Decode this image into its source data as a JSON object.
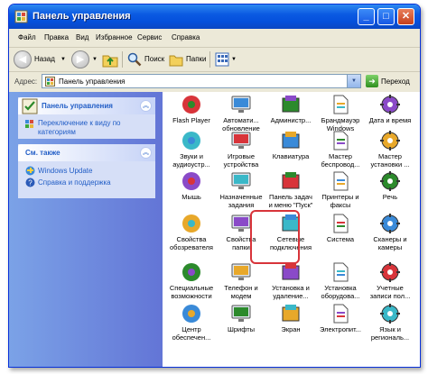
{
  "window": {
    "title": "Панель управления",
    "buttons": {
      "minimize": "_",
      "maximize": "□",
      "close": "✕"
    }
  },
  "menu": [
    "Файл",
    "Правка",
    "Вид",
    "Избранное",
    "Сервис",
    "Справка"
  ],
  "toolbar": {
    "back_label": "Назад",
    "search_label": "Поиск",
    "folders_label": "Папки"
  },
  "address": {
    "label": "Адрес:",
    "value": "Панель управления",
    "go_label": "Переход"
  },
  "sidebar": {
    "control_panel": {
      "title": "Панель управления",
      "link": "Переключение к виду по категориям"
    },
    "see_also": {
      "title": "См. также",
      "links": [
        "Windows Update",
        "Справка и поддержка"
      ]
    }
  },
  "items": [
    {
      "label": "Flash Player",
      "icon": "flash-icon"
    },
    {
      "label": "Автомати...\nобновление",
      "icon": "auto-update-icon"
    },
    {
      "label": "Администр...",
      "icon": "admin-tools-icon"
    },
    {
      "label": "Брандмауэр\nWindows",
      "icon": "firewall-icon"
    },
    {
      "label": "Дата и время",
      "icon": "datetime-icon"
    },
    {
      "label": "Звуки и\nаудиоустр...",
      "icon": "sound-icon"
    },
    {
      "label": "Игровые\nустройства",
      "icon": "game-controller-icon"
    },
    {
      "label": "Клавиатура",
      "icon": "keyboard-icon"
    },
    {
      "label": "Мастер\nбеспровод...",
      "icon": "wireless-wizard-icon"
    },
    {
      "label": "Мастер\nустановки ...",
      "icon": "hardware-wizard-icon"
    },
    {
      "label": "Мышь",
      "icon": "mouse-icon"
    },
    {
      "label": "Назначенные\nзадания",
      "icon": "scheduled-tasks-icon"
    },
    {
      "label": "Панель задач\nи меню \"Пуск\"",
      "icon": "taskbar-icon"
    },
    {
      "label": "Принтеры и\nфаксы",
      "icon": "printer-icon"
    },
    {
      "label": "Речь",
      "icon": "speech-icon"
    },
    {
      "label": "Свойства\nобозревателя",
      "icon": "internet-options-icon"
    },
    {
      "label": "Свойства\nпапки",
      "icon": "folder-options-icon"
    },
    {
      "label": "Сетевые\nподключения",
      "icon": "network-connections-icon"
    },
    {
      "label": "Система",
      "icon": "system-icon"
    },
    {
      "label": "Сканеры и\nкамеры",
      "icon": "scanner-camera-icon"
    },
    {
      "label": "Специальные\nвозможности",
      "icon": "accessibility-icon"
    },
    {
      "label": "Телефон и\nмодем",
      "icon": "phone-modem-icon"
    },
    {
      "label": "Установка и\nудаление...",
      "icon": "add-remove-icon"
    },
    {
      "label": "Установка\nоборудова...",
      "icon": "add-hardware-icon"
    },
    {
      "label": "Учетные\nзаписи пол...",
      "icon": "user-accounts-icon"
    },
    {
      "label": "Центр\nобеспечен...",
      "icon": "security-center-icon"
    },
    {
      "label": "Шрифты",
      "icon": "fonts-icon"
    },
    {
      "label": "Экран",
      "icon": "display-icon"
    },
    {
      "label": "Электропит...",
      "icon": "power-options-icon"
    },
    {
      "label": "Язык и\nрегиональ...",
      "icon": "regional-icon"
    }
  ],
  "highlighted_item": "Сетевые\nподключения",
  "colors": {
    "title_bar": "#0450dc",
    "sidebar_bg": "#7ba2e7",
    "link": "#215dc6",
    "highlight": "#d8343a"
  }
}
